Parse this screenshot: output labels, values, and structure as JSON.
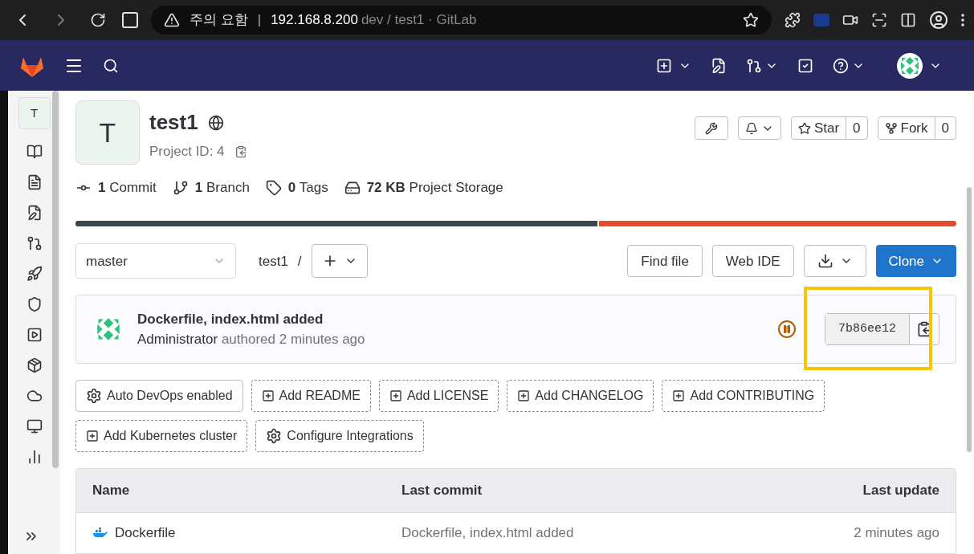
{
  "browser": {
    "security_label": "주의 요함",
    "separator": "|",
    "host": "192.168.8.200",
    "path": "dev / test1 · GitLab"
  },
  "sidebar": {
    "project_letter": "T"
  },
  "project": {
    "avatar_letter": "T",
    "name": "test1",
    "id_label": "Project ID: 4",
    "star_label": "Star",
    "star_count": "0",
    "fork_label": "Fork",
    "fork_count": "0"
  },
  "stats": [
    {
      "value": "1",
      "label": "Commit",
      "kind": "commit"
    },
    {
      "value": "1",
      "label": "Branch",
      "kind": "branch"
    },
    {
      "value": "0",
      "label": "Tags",
      "kind": "tag"
    },
    {
      "value": "72 KB",
      "label": "Project Storage",
      "kind": "storage"
    }
  ],
  "language_bar": {
    "level": 0.594
  },
  "repo_bar": {
    "branch": "master",
    "path": "test1",
    "separator": "/",
    "find_file": "Find file",
    "web_ide": "Web IDE",
    "clone": "Clone"
  },
  "last_commit": {
    "title": "Dockerfile, index.html added",
    "author": "Administrator",
    "meta": "authored 2 minutes ago",
    "sha": "7b86ee12",
    "highlighted": true
  },
  "actions": [
    {
      "label": "Auto DevOps enabled",
      "kind": "gear",
      "dashed": false
    },
    {
      "label": "Add README",
      "kind": "plus",
      "dashed": true
    },
    {
      "label": "Add LICENSE",
      "kind": "plus",
      "dashed": true
    },
    {
      "label": "Add CHANGELOG",
      "kind": "plus",
      "dashed": true
    },
    {
      "label": "Add CONTRIBUTING",
      "kind": "plus",
      "dashed": true
    },
    {
      "label": "Add Kubernetes cluster",
      "kind": "plus",
      "dashed": true
    },
    {
      "label": "Configure Integrations",
      "kind": "gear",
      "dashed": true
    }
  ],
  "table": {
    "columns": [
      "Name",
      "Last commit",
      "Last update"
    ],
    "rows": [
      {
        "name": "Dockerfile",
        "commit": "Dockerfile, index.html added",
        "updated": "2 minutes ago"
      }
    ]
  }
}
